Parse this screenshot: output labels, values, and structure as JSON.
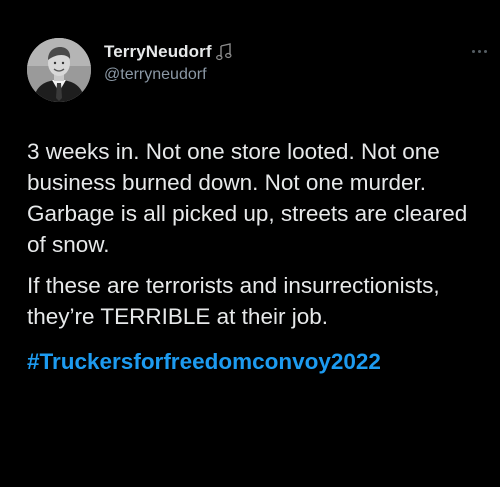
{
  "author": {
    "display_name": "TerryNeudorf",
    "handle": "@terryneudorf",
    "badge_icon": "music-note-icon",
    "avatar_icon": "avatar-photo"
  },
  "header": {
    "more_icon": "more-dots-icon"
  },
  "tweet": {
    "paragraphs": [
      "3 weeks in. Not one store looted. Not one business burned down. Not one murder. Garbage is all picked up, streets are cleared of snow.",
      "If these are terrorists and insurrectionists, they’re TERRIBLE at their job."
    ],
    "hashtag": "#Truckersforfreedomconvoy2022"
  },
  "colors": {
    "background": "#000000",
    "text": "#e7e9ea",
    "secondary_text": "#8b98a5",
    "link": "#1d9bf0"
  }
}
